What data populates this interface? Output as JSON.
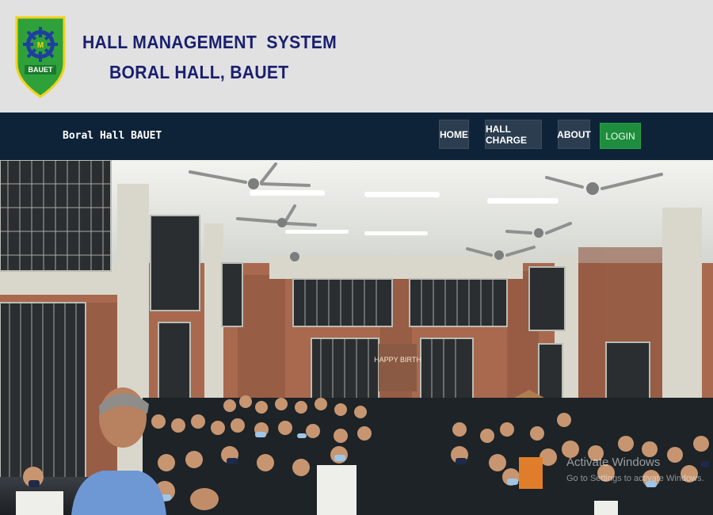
{
  "header": {
    "title_line1": "HALL MANAGEMENT  SYSTEM",
    "title_line2": "BORAL HALL, BAUET",
    "logo_text": "BAUET"
  },
  "navbar": {
    "brand": "Boral Hall BAUET",
    "items": [
      {
        "label": "HOME"
      },
      {
        "label": "HALL CHARGE"
      },
      {
        "label": "ABOUT"
      }
    ],
    "login_label": "LOGIN"
  },
  "hero": {
    "banner_text": "HAPPY BIRTH"
  },
  "watermark": {
    "line1": "Activate Windows",
    "line2": "Go to Settings to activate Windows."
  },
  "colors": {
    "header_bg": "#e1e1e1",
    "title": "#1a1f6e",
    "navbar_bg": "#0e2338",
    "login_bg": "#1e8e3e"
  }
}
